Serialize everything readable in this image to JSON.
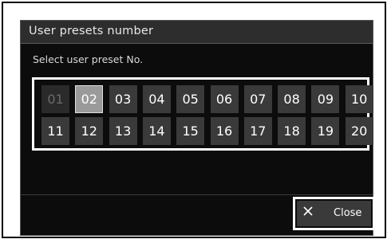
{
  "dialog": {
    "title": "User presets number",
    "subtitle": "Select user preset No.",
    "presets": [
      {
        "label": "01",
        "state": "disabled"
      },
      {
        "label": "02",
        "state": "selected"
      },
      {
        "label": "03",
        "state": "normal"
      },
      {
        "label": "04",
        "state": "normal"
      },
      {
        "label": "05",
        "state": "normal"
      },
      {
        "label": "06",
        "state": "normal"
      },
      {
        "label": "07",
        "state": "normal"
      },
      {
        "label": "08",
        "state": "normal"
      },
      {
        "label": "09",
        "state": "normal"
      },
      {
        "label": "10",
        "state": "normal"
      },
      {
        "label": "11",
        "state": "normal"
      },
      {
        "label": "12",
        "state": "normal"
      },
      {
        "label": "13",
        "state": "normal"
      },
      {
        "label": "14",
        "state": "normal"
      },
      {
        "label": "15",
        "state": "normal"
      },
      {
        "label": "16",
        "state": "normal"
      },
      {
        "label": "17",
        "state": "normal"
      },
      {
        "label": "18",
        "state": "normal"
      },
      {
        "label": "19",
        "state": "normal"
      },
      {
        "label": "20",
        "state": "normal"
      }
    ],
    "close_label": "Close",
    "close_icon": "close-icon"
  }
}
